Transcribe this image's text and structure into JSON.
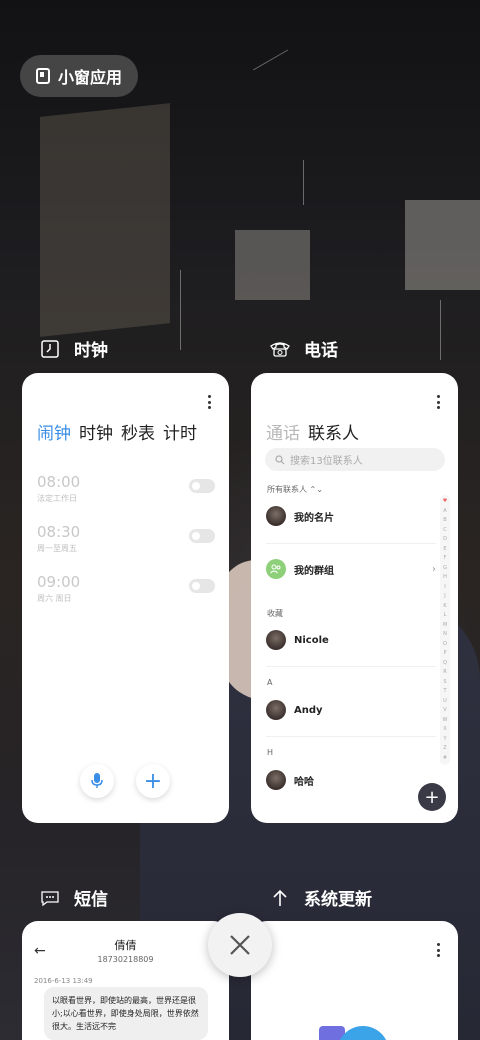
{
  "floating_window": {
    "label": "小窗应用",
    "icon": "small-window-icon"
  },
  "apps": {
    "clock": {
      "title": "时钟",
      "icon": "clock-icon",
      "tabs": [
        "闹钟",
        "时钟",
        "秒表",
        "计时"
      ],
      "alarms": [
        {
          "time": "08:00",
          "repeat": "法定工作日"
        },
        {
          "time": "08:30",
          "repeat": "周一至周五"
        },
        {
          "time": "09:00",
          "repeat": "周六 周日"
        }
      ]
    },
    "phone": {
      "title": "电话",
      "icon": "phone-icon",
      "tabs": [
        "通话",
        "联系人"
      ],
      "search_placeholder": "搜索13位联系人",
      "all_contacts_label": "所有联系人",
      "my_card": "我的名片",
      "my_groups": "我的群组",
      "sections": [
        {
          "header": "收藏",
          "name": "Nicole"
        },
        {
          "header": "A",
          "name": "Andy"
        },
        {
          "header": "H",
          "name": "哈哈"
        }
      ],
      "alphabet": [
        "♥",
        "A",
        "B",
        "C",
        "D",
        "E",
        "F",
        "G",
        "H",
        "I",
        "J",
        "K",
        "L",
        "M",
        "N",
        "O",
        "P",
        "Q",
        "R",
        "S",
        "T",
        "U",
        "V",
        "W",
        "X",
        "Y",
        "Z",
        "#"
      ]
    },
    "sms": {
      "title": "短信",
      "icon": "message-icon",
      "contact_name": "倩倩",
      "contact_number": "18730218809",
      "date": "2016-6-13 13:49",
      "message": "以眼看世界，即使站的最高，世界还是很小;以心看世界，即使身处局限，世界依然很大。生活远不完"
    },
    "update": {
      "title": "系统更新",
      "icon": "update-arrow-icon"
    }
  }
}
